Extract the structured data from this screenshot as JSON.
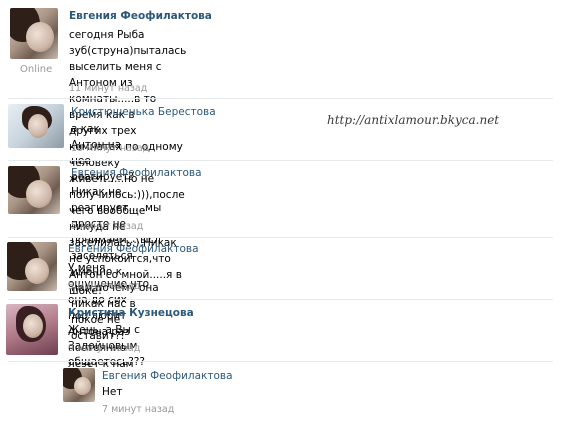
{
  "watermark": "http://antixlamour.bkyca.net",
  "posts": [
    {
      "author": "Евгения Феофилактова",
      "status": "Online",
      "lines": [
        "сегодня Рыба зуб(струна)пыталась выселить меня с Антоном из комнаты.....в то время как в",
        "других трех комнатах по одному человеку живет......но не получилось:))),после чего вооббще",
        "никуда не заселилась:).Никак не успокоится,что Антон со мной.....я в шоке!"
      ],
      "time": "11 минут назад"
    },
    {
      "author": "Кристюшенька Берестова",
      "lines": [
        "а как Антон на нее реагирует?"
      ],
      "time": "10 минут назад"
    },
    {
      "author": "Евгения Феофилактова",
      "lines": [
        "Никак не реагирует.....мы просто не понимаем....ысл заселяться именно к нам,почему она",
        "никак нас в покое не оставит?!"
      ],
      "time": "5 минут назад"
    },
    {
      "author": "Евгения Феофилактова",
      "lines": [
        "У меня ощущение,что она до сих пор любит Антона раз постоянно лезет к нам"
      ],
      "time": "5 минут назад"
    },
    {
      "author": "Кристина Кузнецова",
      "lines": [
        "Жень, а Вы с Задойновым общаетесь???"
      ],
      "time": "9 минут назад"
    },
    {
      "author": "Евгения Феофилактова",
      "lines": [
        "Нет"
      ],
      "time": "7 минут назад"
    }
  ]
}
